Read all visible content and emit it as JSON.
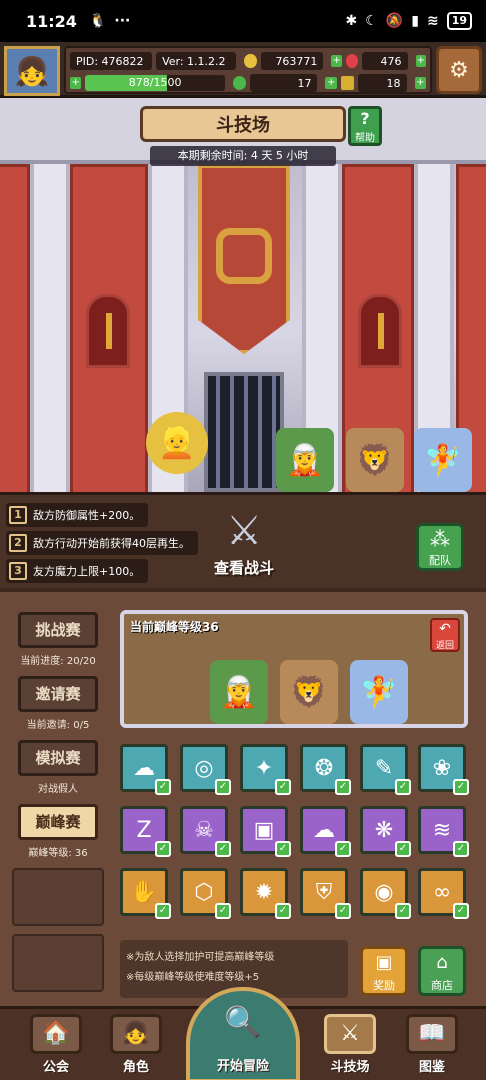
{
  "status_bar": {
    "time": "11:24",
    "battery": "19"
  },
  "profile": {
    "pid": "PID: 476822",
    "version": "Ver: 1.1.2.2",
    "exp": "878/1500",
    "exp_fraction": 0.585
  },
  "resources": {
    "gold": "763771",
    "gems": "476",
    "clover": "17",
    "boots": "18"
  },
  "arena": {
    "title": "斗技场",
    "help_label": "帮助",
    "season_remaining": "本期剩余时间: 4 天 5 小时"
  },
  "modifiers": [
    {
      "num": "1",
      "text": "敌方防御属性+200。"
    },
    {
      "num": "2",
      "text": "敌方行动开始前获得40层再生。"
    },
    {
      "num": "3",
      "text": "友方魔力上限+100。"
    }
  ],
  "view_battle_label": "查看战斗",
  "team_label": "配队",
  "modes": [
    {
      "label": "挑战赛",
      "sub": "当前进度: 20/20",
      "active": false
    },
    {
      "label": "邀请赛",
      "sub": "当前邀请: 0/5",
      "active": false
    },
    {
      "label": "模拟赛",
      "sub": "对战假人",
      "active": false
    },
    {
      "label": "巅峰赛",
      "sub": "巅峰等级: 36",
      "active": true
    }
  ],
  "peak": {
    "current_level": "当前巅峰等级36",
    "back_label": "返回"
  },
  "buffs": {
    "row0": [
      "☁",
      "◎",
      "✦",
      "❂",
      "✎",
      "❀"
    ],
    "row1": [
      "Z",
      "☠",
      "▣",
      "☁",
      "❋",
      "≋"
    ],
    "row2": [
      "✋",
      "⬡",
      "✹",
      "⛨",
      "◉",
      "∞"
    ]
  },
  "notes": [
    "※为敌人选择加护可提高巅峰等级",
    "※每级巅峰等级使难度等级+5"
  ],
  "reward_label": "奖励",
  "shop_label": "商店",
  "nav": {
    "guild": "公会",
    "character": "角色",
    "adventure": "开始冒险",
    "arena": "斗技场",
    "codex": "图鉴"
  }
}
